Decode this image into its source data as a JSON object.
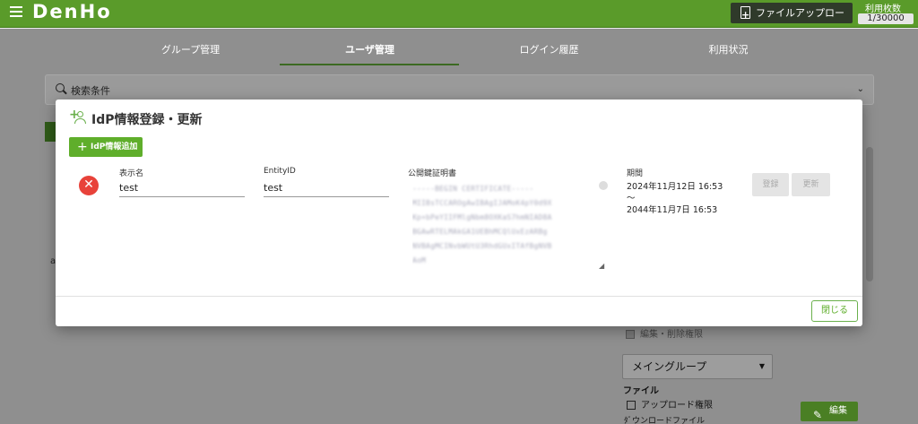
{
  "header": {
    "logo": "DenHo",
    "upload_button": "ファイルアップロード",
    "usage_label": "利用枚数",
    "usage_count": "1/30000"
  },
  "tabs": [
    {
      "label": "グループ管理",
      "active": false
    },
    {
      "label": "ユーザ管理",
      "active": true
    },
    {
      "label": "ログイン履歴",
      "active": false
    },
    {
      "label": "利用状況",
      "active": false
    }
  ],
  "search": {
    "label": "検索条件"
  },
  "background": {
    "char_a": "a",
    "edit_perm": "編集・削除権限",
    "main_group": "メイングループ",
    "file_section": "ファイル",
    "upload_perm": "アップロード権限",
    "edit_button": "編集",
    "bottom_text": "ﾀﾞウンロードファイル"
  },
  "modal": {
    "title": "IdP情報登録・更新",
    "add_button": "IdP情報追加",
    "entry": {
      "display_name_label": "表示名",
      "display_name_value": "test",
      "entity_id_label": "EntityID",
      "entity_id_value": "test",
      "cert_label": "公開鍵証明書",
      "cert_lines": [
        "-----BEGIN CERTIFICATE-----",
        "MIIBsTCCAROgAwIBAgIJAMoK4pY0d9X",
        "Kp+bPeYIIFMlgNbm8OXKaS7hmNIAD8A",
        "BGAwRTELMAkGA1UEBhMCQlUxEzARBg",
        "NVBAgMCINvbWUtU3RhdGUxITAfBgNVB",
        "AoM"
      ],
      "period_label": "期間",
      "period_start": "2024年11月12日 16:53",
      "period_sep": "～",
      "period_end": "2044年11月7日 16:53",
      "register_button": "登録",
      "update_button": "更新"
    },
    "close_button": "閉じる"
  },
  "colors": {
    "brand_green": "#5a9b2a",
    "accent_green": "#5fae2b",
    "delete_red": "#e8423a"
  }
}
